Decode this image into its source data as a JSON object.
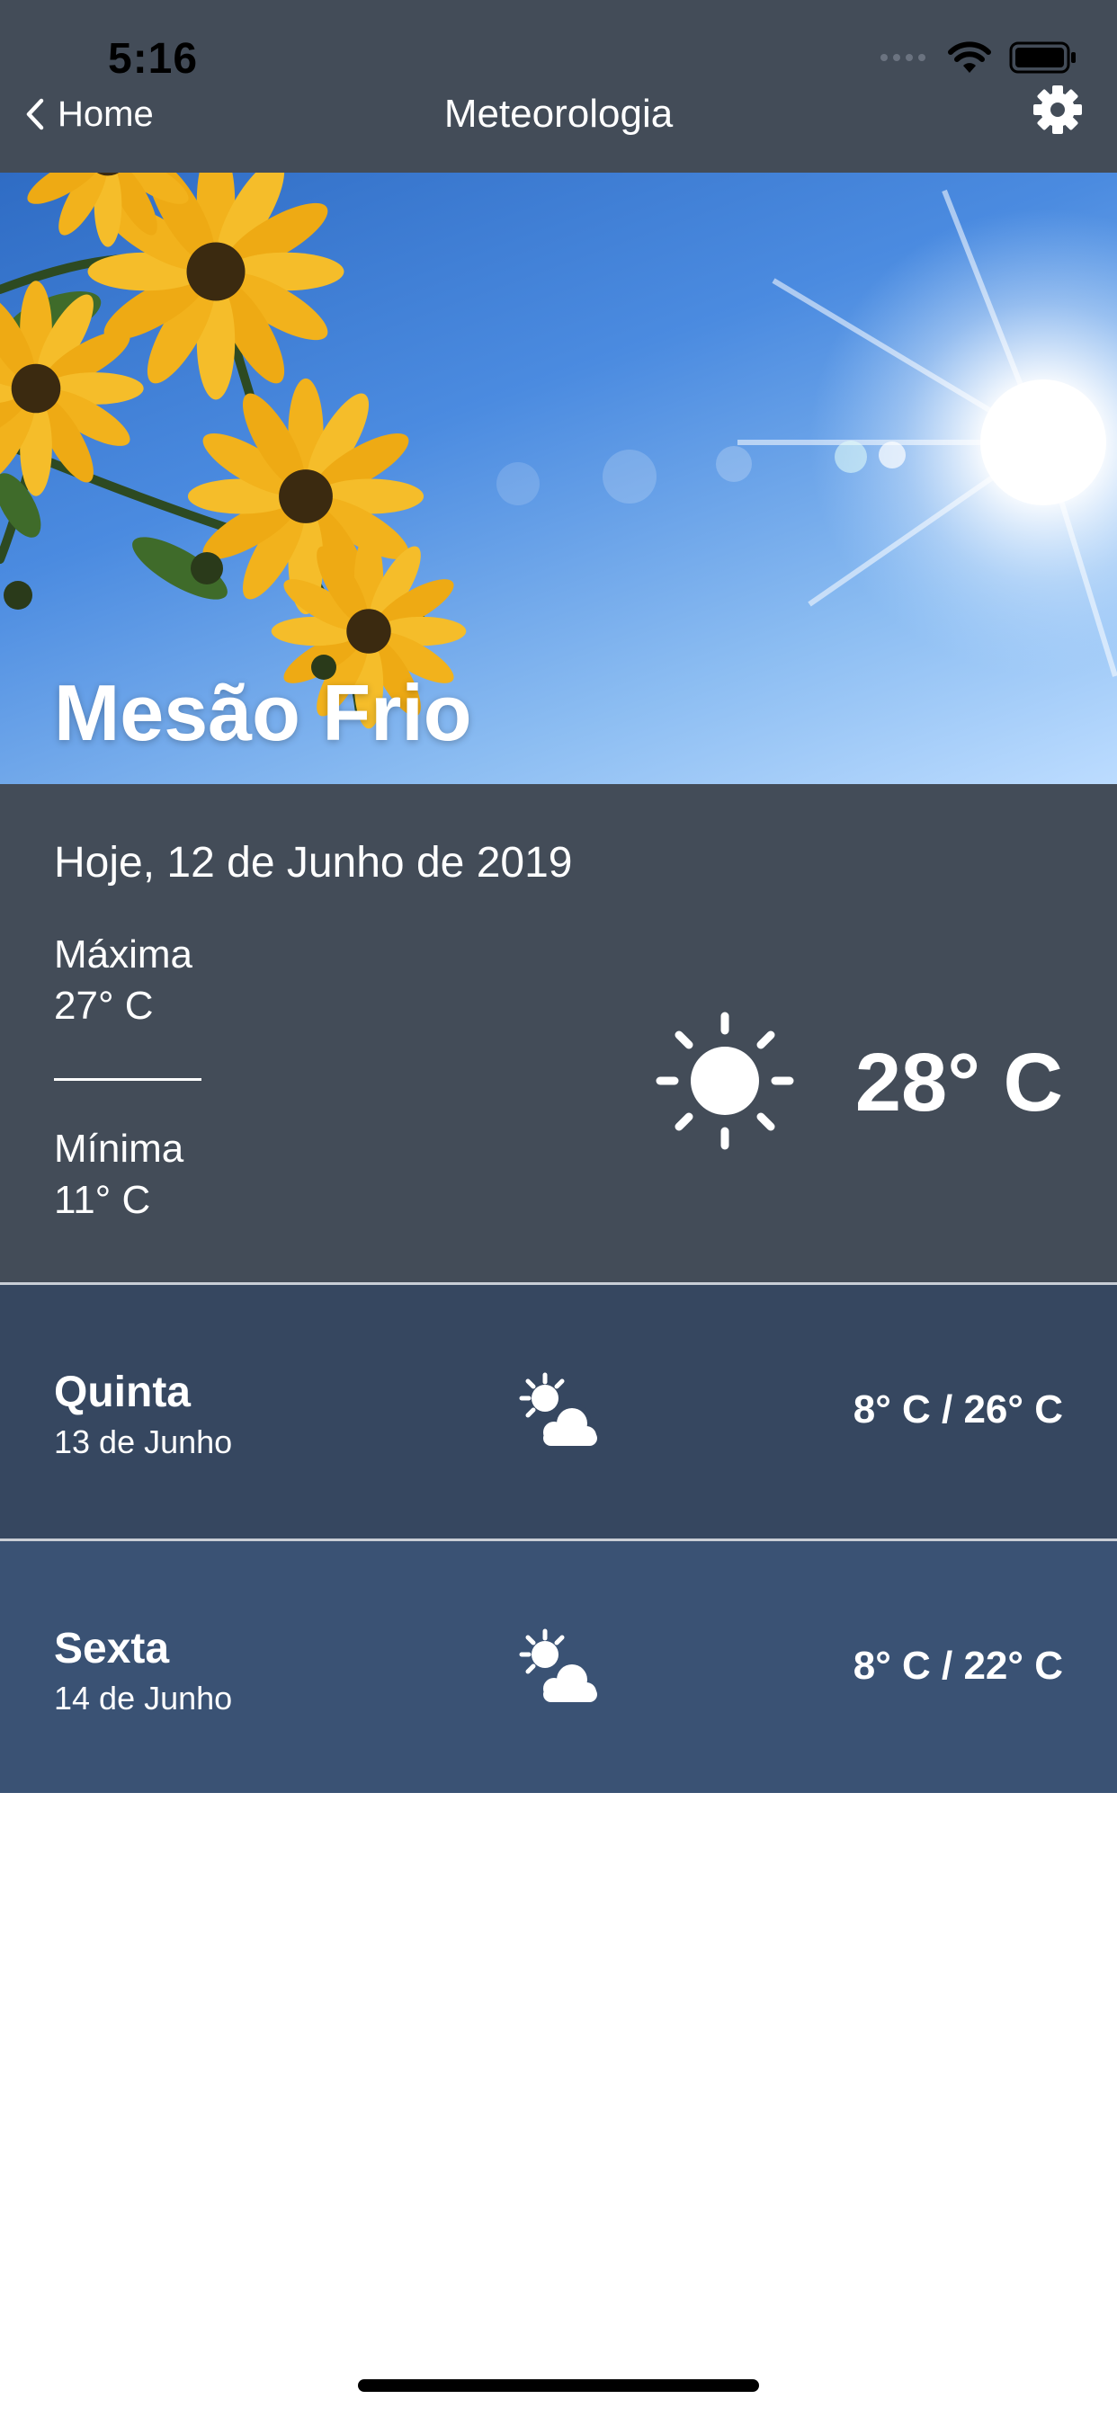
{
  "status_bar": {
    "time": "5:16"
  },
  "nav": {
    "back_label": "Home",
    "title": "Meteorologia",
    "settings_icon": "gear-icon"
  },
  "hero": {
    "city": "Mesão Frio"
  },
  "today": {
    "date": "Hoje, 12 de Junho de 2019",
    "max_label": "Máxima",
    "max_value": "27° C",
    "min_label": "Mínima",
    "min_value": "11° C",
    "condition_icon": "sun-icon",
    "current_temp": "28° C"
  },
  "forecast": [
    {
      "day": "Quinta",
      "date": "13 de Junho",
      "icon": "partly-cloudy-icon",
      "temp_range": "8° C / 26° C",
      "background": "#364760"
    },
    {
      "day": "Sexta",
      "date": "14 de Junho",
      "icon": "partly-cloudy-icon",
      "temp_range": "8° C / 22° C",
      "background": "#3a5274"
    }
  ],
  "colors": {
    "header_bg": "#434c58",
    "today_bg": "#434c58",
    "divider": "#c9ced6",
    "text": "#ffffff"
  }
}
